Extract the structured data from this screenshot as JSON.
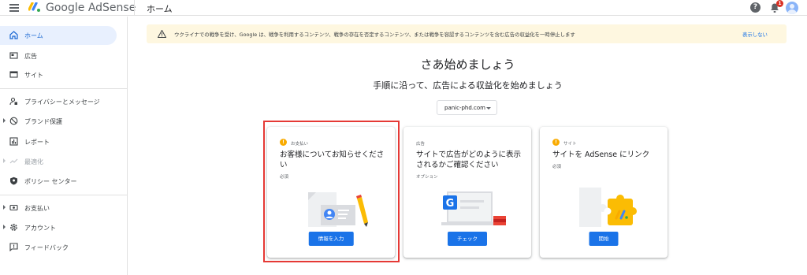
{
  "app": {
    "brand": "Google AdSense",
    "page_title": "ホーム",
    "notification_count": "1"
  },
  "sidebar": {
    "items": [
      {
        "label": "ホーム",
        "icon": "home-icon",
        "active": true
      },
      {
        "label": "広告",
        "icon": "ads-icon"
      },
      {
        "label": "サイト",
        "icon": "sites-icon"
      },
      {
        "label": "プライバシーとメッセージ",
        "icon": "privacy-icon"
      },
      {
        "label": "ブランド保護",
        "icon": "block-icon"
      },
      {
        "label": "レポート",
        "icon": "reports-icon"
      },
      {
        "label": "最適化",
        "icon": "optimize-icon",
        "disabled": true
      },
      {
        "label": "ポリシー センター",
        "icon": "policy-icon"
      },
      {
        "label": "お支払い",
        "icon": "payments-icon"
      },
      {
        "label": "アカウント",
        "icon": "gear-icon"
      },
      {
        "label": "フィードバック",
        "icon": "feedback-icon"
      }
    ]
  },
  "banner": {
    "text": "ウクライナでの戦争を受け、Google は、戦争を利用するコンテンツ、戦争の存在を否定するコンテンツ、または戦争を容認するコンテンツを含む広告の収益化を一時停止します",
    "dismiss_label": "表示しない",
    "accent": "#fef7e0"
  },
  "main": {
    "title": "さあ始めましょう",
    "subtitle": "手順に沿って、広告による収益化を始めましょう",
    "site_select": "panic-phd.com"
  },
  "cards": [
    {
      "category": "お支払い",
      "title": "お客様についてお知らせください",
      "status": "必須",
      "button": "情報を入力",
      "highlighted": true
    },
    {
      "category": "広告",
      "title": "サイトで広告がどのように表示されるかご確認ください",
      "status": "オプション",
      "button": "チェック"
    },
    {
      "category": "サイト",
      "title": "サイトを AdSense にリンク",
      "status": "必須",
      "button": "開始"
    }
  ],
  "colors": {
    "primary": "#1a73e8",
    "highlight_border": "#e53935",
    "warning": "#f9ab00"
  }
}
